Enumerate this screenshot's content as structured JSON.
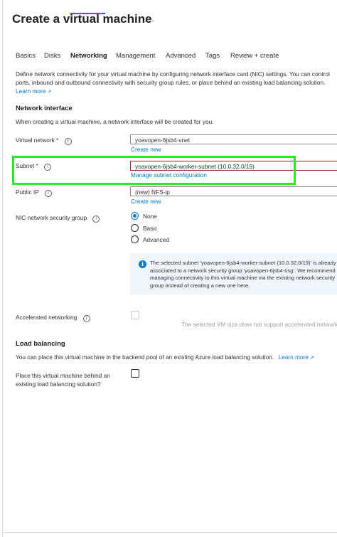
{
  "header": {
    "title": "Create a virtual machine",
    "more": "···"
  },
  "tabs": [
    {
      "label": "Basics"
    },
    {
      "label": "Disks"
    },
    {
      "label": "Networking",
      "active": true
    },
    {
      "label": "Management"
    },
    {
      "label": "Advanced"
    },
    {
      "label": "Tags"
    },
    {
      "label": "Review + create"
    }
  ],
  "description": {
    "line1": "Define network connectivity for your virtual machine by configuring network interface card (NIC) settings. You can control",
    "line2": "ports, inbound and outbound connectivity with security group rules, or place behind an existing load balancing solution.",
    "learn_more": "Learn more"
  },
  "network_interface": {
    "title": "Network interface",
    "subtitle": "When creating a virtual machine, a network interface will be created for you.",
    "virtual_network": {
      "label": "Virtual network",
      "required": "*",
      "value": "yoavopen-6jsb4-vnet",
      "link": "Create new"
    },
    "subnet": {
      "label": "Subnet",
      "required": "*",
      "value": "yoavopen-6jsb4-worker-subnet (10.0.32.0/19)",
      "link": "Manage subnet configuration"
    },
    "public_ip": {
      "label": "Public IP",
      "value": "(new) NFS-ip",
      "link": "Create new"
    },
    "nic_nsg": {
      "label": "NIC network security group",
      "options": [
        {
          "label": "None",
          "selected": true
        },
        {
          "label": "Basic",
          "selected": false
        },
        {
          "label": "Advanced",
          "selected": false
        }
      ],
      "info": {
        "line1": "The selected subnet 'yoavopen-6jsb4-worker-subnet (10.0.32.0/19)' is already",
        "line2": "associated to a network security group 'yoavopen-6jsb4-nsg'. We recommend",
        "line3": "managing connectivity to this virtual machine via the existing network security",
        "line4": "group instead of creating a new one here."
      }
    },
    "accelerated_networking": {
      "label": "Accelerated networking",
      "note": "The selected VM size does not support accelerated network"
    }
  },
  "load_balancing": {
    "title": "Load balancing",
    "description": "You can place this virtual machine in the backend pool of an existing Azure load balancing solution.",
    "learn_more": "Learn more",
    "checkbox_label_line1": "Place this virtual machine behind an",
    "checkbox_label_line2": "existing load balancing solution?"
  },
  "colors": {
    "accent": "#0078d4",
    "highlight": "#22ee22",
    "required": "#a4262c"
  }
}
